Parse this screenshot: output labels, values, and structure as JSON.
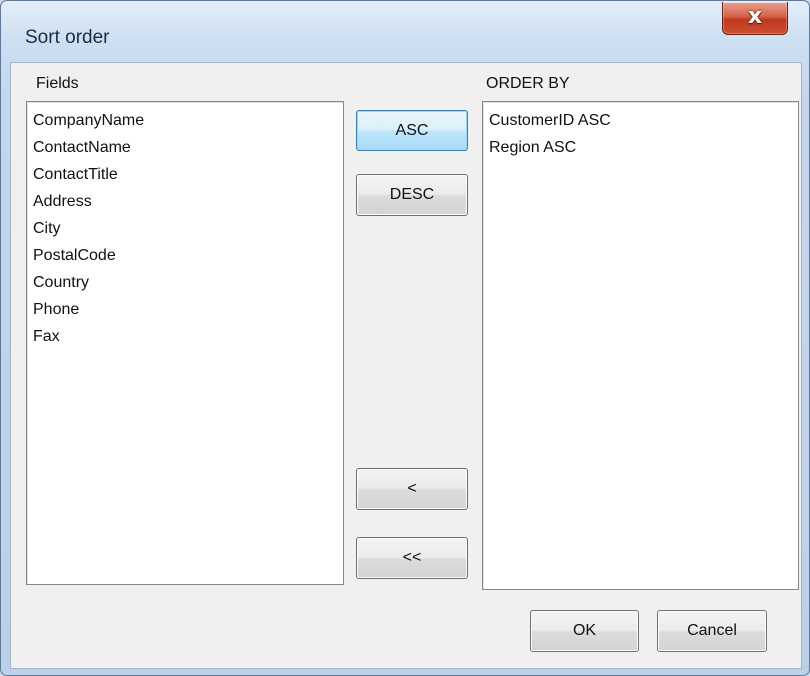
{
  "window": {
    "title": "Sort order",
    "close_glyph": "x"
  },
  "fields": {
    "label": "Fields",
    "items": [
      "CompanyName",
      "ContactName",
      "ContactTitle",
      "Address",
      "City",
      "PostalCode",
      "Country",
      "Phone",
      "Fax"
    ]
  },
  "order_by": {
    "label": "ORDER BY",
    "items": [
      "CustomerID ASC",
      "Region ASC"
    ]
  },
  "buttons": {
    "asc": "ASC",
    "desc": "DESC",
    "remove": "<",
    "remove_all": "<<",
    "ok": "OK",
    "cancel": "Cancel"
  }
}
